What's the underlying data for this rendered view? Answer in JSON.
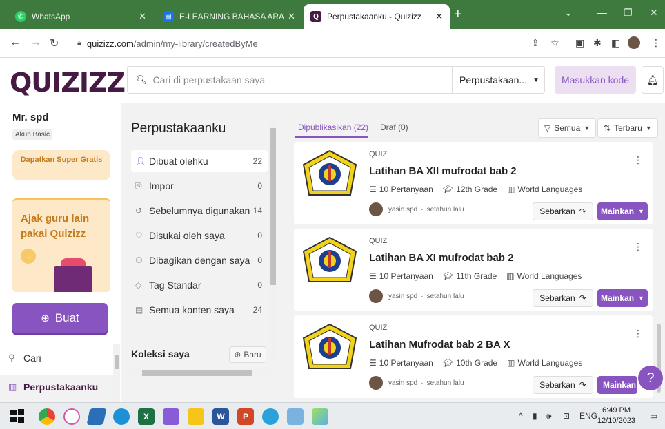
{
  "browser": {
    "tabs": [
      {
        "title": "WhatsApp",
        "active": false
      },
      {
        "title": "E-LEARNING BAHASA ARAB MA",
        "active": false
      },
      {
        "title": "Perpustakaanku - Quizizz",
        "active": true
      }
    ],
    "url_host": "quizizz.com",
    "url_path": "/admin/my-library/createdByMe"
  },
  "header": {
    "logo": "QUIZIZZ",
    "search_placeholder": "Cari di perpustakaan saya",
    "library_select": "Perpustakaan...",
    "enter_code": "Masukkan kode"
  },
  "sidebar": {
    "user_name": "Mr. spd",
    "account_type": "Akun Basic",
    "super_button": "Dapatkan Super Gratis",
    "invite_text": "Ajak guru lain pakai Quizizz",
    "create_button": "Buat",
    "nav": [
      {
        "label": "Cari"
      },
      {
        "label": "Perpustakaanku"
      }
    ]
  },
  "library": {
    "title": "Perpustakaanku",
    "items": [
      {
        "label": "Dibuat olehku",
        "count": "22"
      },
      {
        "label": "Impor",
        "count": "0"
      },
      {
        "label": "Sebelumnya digunakan",
        "count": "14"
      },
      {
        "label": "Disukai oleh saya",
        "count": "0"
      },
      {
        "label": "Dibagikan dengan saya",
        "count": "0"
      },
      {
        "label": "Tag Standar",
        "count": "0"
      },
      {
        "label": "Semua konten saya",
        "count": "24"
      }
    ],
    "collections_title": "Koleksi saya",
    "new_collection": "Baru"
  },
  "content": {
    "tab_published": "Dipublikasikan (22)",
    "tab_draft": "Draf (0)",
    "filter_all": "Semua",
    "filter_sort": "Terbaru",
    "quizzes": [
      {
        "type": "QUIZ",
        "title": "Latihan BA XII mufrodat bab 2",
        "questions": "10 Pertanyaan",
        "grade": "12th Grade",
        "subject": "World Languages",
        "author": "yasin spd",
        "time": "setahun lalu"
      },
      {
        "type": "QUIZ",
        "title": "Latihan BA XI mufrodat bab 2",
        "questions": "10 Pertanyaan",
        "grade": "11th Grade",
        "subject": "World Languages",
        "author": "yasin spd",
        "time": "setahun lalu"
      },
      {
        "type": "QUIZ",
        "title": "Latihan Mufrodat bab 2 BA X",
        "questions": "10 Pertanyaan",
        "grade": "10th Grade",
        "subject": "World Languages",
        "author": "yasin spd",
        "time": "setahun lalu"
      }
    ],
    "share_label": "Sebarkan",
    "play_label": "Mainkan"
  },
  "taskbar": {
    "lang": "ENG",
    "time": "6:49 PM",
    "date": "12/10/2023"
  },
  "colors": {
    "brand_purple": "#8854c0",
    "logo_dark": "#461a42",
    "browser_green": "#3e7a3e"
  }
}
